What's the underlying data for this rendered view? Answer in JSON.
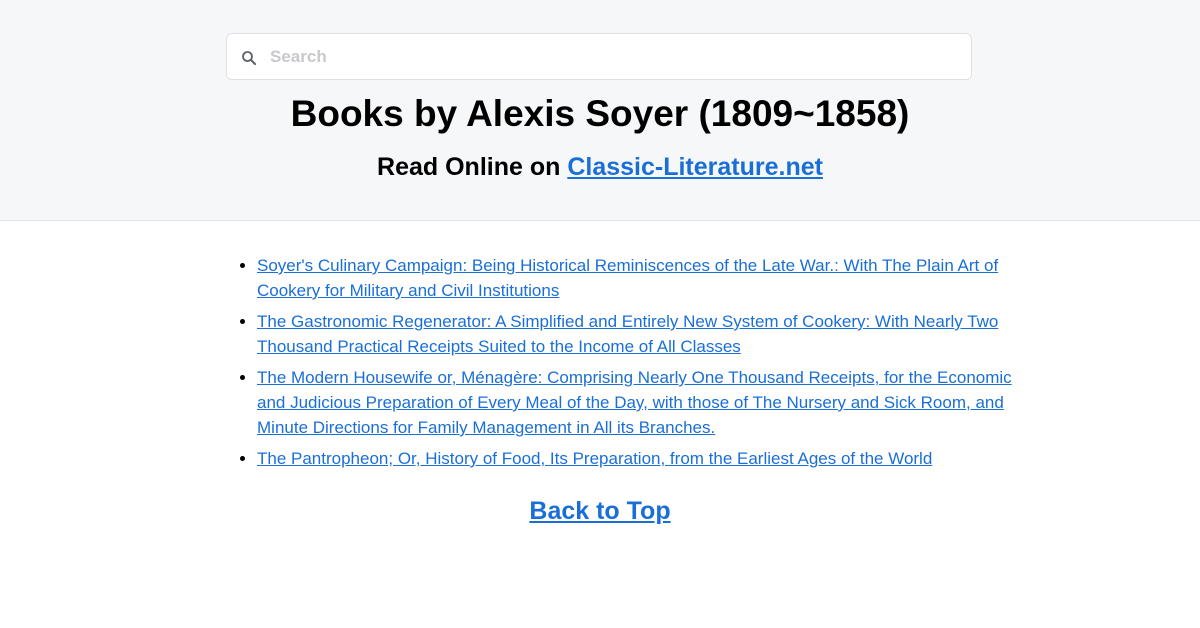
{
  "search": {
    "placeholder": "Search"
  },
  "header": {
    "title": "Books by Alexis Soyer (1809~1858)",
    "subtitle_prefix": "Read Online on ",
    "subtitle_link": "Classic-Literature.net"
  },
  "books": [
    {
      "title": "Soyer's Culinary Campaign: Being Historical Reminiscences of the Late War.: With The Plain Art of Cookery for Military and Civil Institutions"
    },
    {
      "title": "The Gastronomic Regenerator: A Simplified and Entirely New System of Cookery: With Nearly Two Thousand Practical Receipts Suited to the Income of All Classes"
    },
    {
      "title": "The Modern Housewife or, Ménagère: Comprising Nearly One Thousand Receipts, for the Economic and Judicious Preparation of Every Meal of the Day, with those of The Nursery and Sick Room, and Minute Directions for Family Management in All its Branches."
    },
    {
      "title": "The Pantropheon; Or, History of Food, Its Preparation, from the Earliest Ages of the World"
    }
  ],
  "footer": {
    "back_to_top": "Back to Top"
  },
  "colors": {
    "link": "#1a6fd6",
    "header_bg": "#f6f7f9"
  }
}
